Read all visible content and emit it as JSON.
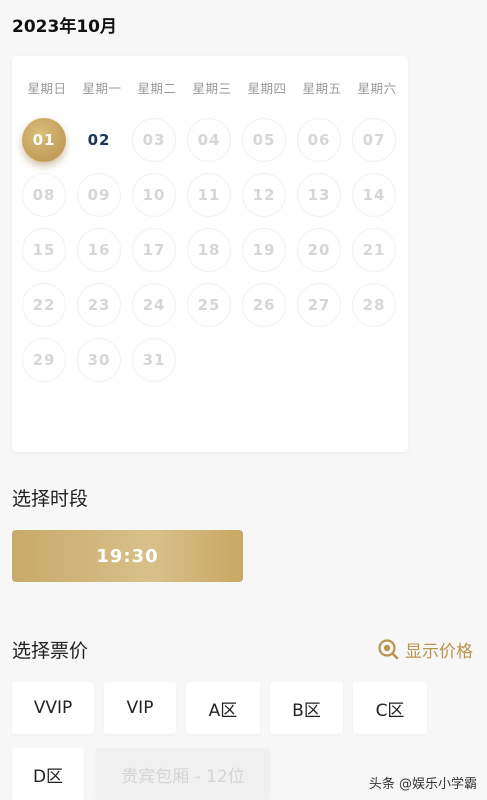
{
  "header": {
    "month_title": "2023年10月"
  },
  "calendar": {
    "weekdays": [
      "星期日",
      "星期一",
      "星期二",
      "星期三",
      "星期四",
      "星期五",
      "星期六"
    ],
    "days": [
      "01",
      "02",
      "03",
      "04",
      "05",
      "06",
      "07",
      "08",
      "09",
      "10",
      "11",
      "12",
      "13",
      "14",
      "15",
      "16",
      "17",
      "18",
      "19",
      "20",
      "21",
      "22",
      "23",
      "24",
      "25",
      "26",
      "27",
      "28",
      "29",
      "30",
      "31"
    ],
    "selected": "01",
    "available": [
      "02"
    ]
  },
  "time_section": {
    "title": "选择时段",
    "slots": [
      "19:30"
    ]
  },
  "price_section": {
    "title": "选择票价",
    "show_price_label": "显示价格",
    "tiers": [
      "VVIP",
      "VIP",
      "A区",
      "B区",
      "C区",
      "D区"
    ],
    "disabled_tier": "贵宾包厢 - 12位"
  },
  "watermark": "头条 @娱乐小学霸",
  "colors": {
    "accent": "#c8a96a",
    "date_text": "#1d3557"
  }
}
